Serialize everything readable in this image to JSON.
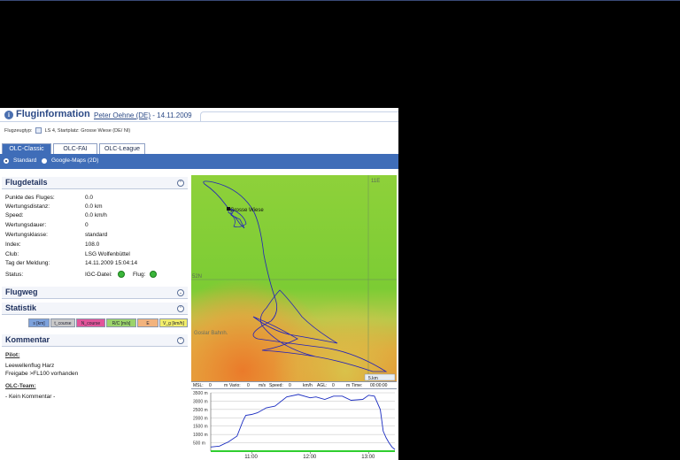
{
  "header": {
    "title": "Fluginformation",
    "pilot_link": "Peter Oehne (DE)",
    "date": " - 14.11.2009",
    "flugzeugtyp_label": "Flugzeugtyp:",
    "flugzeugtyp_value": "LS 4, Startplatz: Grosse Wiese (DE/ NI)"
  },
  "tabs": [
    {
      "label": "OLC-Classic",
      "active": true
    },
    {
      "label": "OLC-FAI",
      "active": false
    },
    {
      "label": "OLC-League",
      "active": false
    }
  ],
  "view_options": {
    "standard": "Standard",
    "google_maps": "Google-Maps (2D)",
    "selected": "Standard"
  },
  "flugdetails": {
    "title": "Flugdetails",
    "rows": [
      {
        "label": "Punkte des Fluges:",
        "value": "0.0"
      },
      {
        "label": "Wertungsdistanz:",
        "value": "0.0 km"
      },
      {
        "label": "Speed:",
        "value": "0.0 km/h"
      },
      {
        "label": "Wertungsdauer:",
        "value": "0"
      },
      {
        "label": "Wertungsklasse:",
        "value": "standard"
      },
      {
        "label": "Index:",
        "value": "108.0"
      },
      {
        "label": "Club:",
        "value": "LSG Wolfenbüttel"
      },
      {
        "label": "Tag der Meldung:",
        "value": "14.11.2009 15:04:14"
      }
    ],
    "status_label": "Status:",
    "igc_label": "IGC-Datei:",
    "flug_label": "Flug:"
  },
  "flugweg": {
    "title": "Flugweg"
  },
  "statistik": {
    "title": "Statistik",
    "buttons": [
      {
        "label": "s [km]",
        "color": "#7da2dc"
      },
      {
        "label": "t_course",
        "color": "#c8c8c8"
      },
      {
        "label": "N_course",
        "color": "#e2559a"
      },
      {
        "label": "R/C [m/s]",
        "color": "#9bd36b"
      },
      {
        "label": "E",
        "color": "#f2b37d"
      },
      {
        "label": "V_g [km/h]",
        "color": "#f2ee6a"
      }
    ]
  },
  "kommentar": {
    "title": "Kommentar",
    "pilot_heading": "Pilot:",
    "pilot_line1": "Leewellenflug Harz",
    "pilot_line2": "Freigabe >FL100 vorhanden",
    "team_heading": "OLC-Team:",
    "team_text": "- Kein Kommentar -"
  },
  "map": {
    "label_place": "Grosse Wiese",
    "label_city": "Goslar Bahnh.",
    "grid_label_top": "11E",
    "grid_label_lat": "52N",
    "scale": "5.km"
  },
  "statusbar": {
    "msl_label": "MSL:",
    "msl_value": "0",
    "msl_unit": "m",
    "vario_label": "Vario:",
    "vario_value": "0",
    "vario_unit": "m/s",
    "speed_label": "Speed:",
    "speed_value": "0",
    "speed_unit": "km/h",
    "agl_label": "AGL:",
    "agl_value": "0",
    "agl_unit": "m",
    "time_label": "Time:",
    "time_value": "00:00:00"
  },
  "chart_data": {
    "type": "line",
    "title": "",
    "xlabel": "",
    "ylabel": "",
    "y_ticks": [
      "3500 m",
      "3000 m",
      "2500 m",
      "2000 m",
      "1500 m",
      "1000 m",
      "500 m"
    ],
    "x_ticks": [
      "11:00",
      "12:00",
      "13:00"
    ],
    "ylim": [
      0,
      3500
    ],
    "xlim": [
      10.3,
      13.45
    ],
    "grid": true,
    "series": [
      {
        "color": "#1a2cc0",
        "x": [
          10.3,
          10.45,
          10.6,
          10.75,
          10.85,
          10.9,
          11.0,
          11.1,
          11.25,
          11.4,
          11.6,
          11.8,
          12.0,
          12.1,
          12.25,
          12.4,
          12.55,
          12.7,
          12.9,
          13.0,
          13.1,
          13.2,
          13.25,
          13.3,
          13.35,
          13.4,
          13.45
        ],
        "y": [
          250,
          300,
          550,
          900,
          1800,
          2150,
          2200,
          2300,
          2600,
          2700,
          3250,
          3400,
          3200,
          3250,
          3100,
          3300,
          3300,
          3050,
          3100,
          3350,
          3300,
          2500,
          1200,
          800,
          500,
          250,
          100
        ]
      },
      {
        "color": "#2fce2f",
        "x": [
          10.3,
          13.45
        ],
        "y": [
          0,
          0
        ]
      }
    ]
  }
}
